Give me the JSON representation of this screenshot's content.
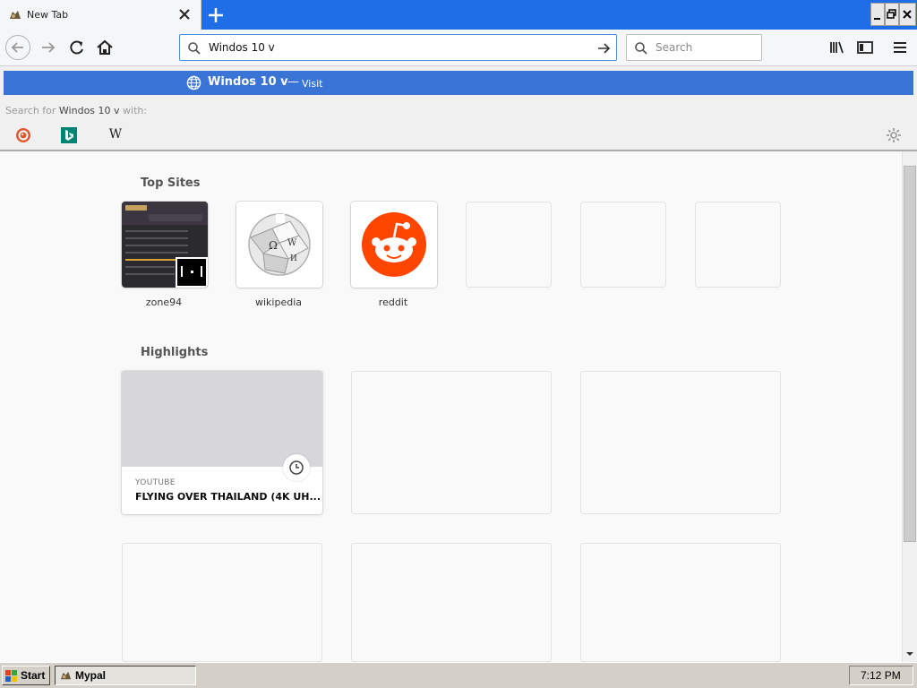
{
  "tab": {
    "title": "New Tab",
    "favicon": "mypal-icon"
  },
  "navbar": {
    "url_value": "Windos 10 v",
    "search_placeholder": "Search"
  },
  "dropdown": {
    "suggestion_title": "Windos 10 v",
    "suggestion_sep": "—",
    "suggestion_action": "Visit",
    "search_with_prefix": "Search for ",
    "search_with_query": "Windos 10 v",
    "search_with_suffix": " with:",
    "engines": [
      "duckduckgo-icon",
      "bing-icon",
      "wikipedia-icon"
    ],
    "wikipedia_letter": "W"
  },
  "top_sites": {
    "title": "Top Sites",
    "items": [
      {
        "label": "zone94"
      },
      {
        "label": "wikipedia"
      },
      {
        "label": "reddit"
      }
    ]
  },
  "highlights": {
    "title": "Highlights",
    "card": {
      "source": "YOUTUBE",
      "title": "FLYING OVER THAILAND (4K UH..."
    }
  },
  "taskbar": {
    "start_label": "Start",
    "task_label": "Mypal",
    "clock": "7:12 PM"
  },
  "colors": {
    "tab_strip": "#1e6fe6",
    "suggestion_row": "#3a74d4",
    "reddit": "#ff4500"
  }
}
